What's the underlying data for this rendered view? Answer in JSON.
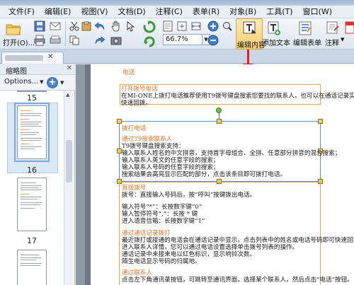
{
  "menu": [
    "文件(F)",
    "编辑(E)",
    "视图(V)",
    "文档(D)",
    "注释(C)",
    "表单(R)",
    "对象(B)",
    "工具(T)",
    "窗口(W)"
  ],
  "toolbar": {
    "open_label": "打开(O)...",
    "zoom_value": "66.7%",
    "edit_content_label": "编辑内容",
    "add_text_label": "添加文本",
    "edit_form_label": "编辑表单",
    "comment_label": "注释"
  },
  "panel": {
    "title": "缩略图",
    "options_label": "Options...",
    "pages": [
      "15",
      "16",
      "17"
    ]
  },
  "document": {
    "heading1": "电话",
    "sub1": "打开拨号电话",
    "para1": [
      "在MI-ONE上拨打电话推荐使用T9拨号键盘搜索您要找的联系人，也可以在通话记录实",
      "快速回拨。"
    ],
    "sub2": "拨打电话",
    "sub2b": "通过T9搜索联系人",
    "para2": [
      "T9拨号键盘搜索支持：",
      "输入联系人姓名的中文拼音，支持首字母组合、全拼、任意部分拼音的混合搜索；",
      "输入联系人英文的任意字段的搜索；",
      "输入联系人号码的任意字段的搜索；",
      "搜索结果会高亮显示匹配的部分，点击该条目即可拨打电话。"
    ],
    "sub3": "直接拨号",
    "para3": [
      "拨号：直接输入号码后，按“呼叫”按键拨出电话。"
    ],
    "para4": [
      "输入符号“*”：长按数字键“0”",
      "输入暂停符号“,”：长按 * 键",
      "进入语音信箱：长按数字键“1”"
    ],
    "sub4": "通过通话记录拨打",
    "para5": [
      "最近拨打或接通的电话会在通话记录中显示，点击列表中的姓名或电话号码即可快速回拨",
      "进入联系人详情，您可以通过电话设置选择单击拨号列表的操作。",
      "通话记录中未接来电以红色标识，显示响铃次数。",
      "陌生电话显示号码的归属地。"
    ],
    "sub5": "通过联系人",
    "para6": [
      "点击左下角通讯录按钮，可跳转至通讯界面，选择某个联系人，然后点击“电话”按钮。"
    ]
  },
  "colors": {
    "accent_orange": "#e07a2c",
    "arrow_red": "#e02020",
    "selection_blue": "#5b8bd0"
  }
}
